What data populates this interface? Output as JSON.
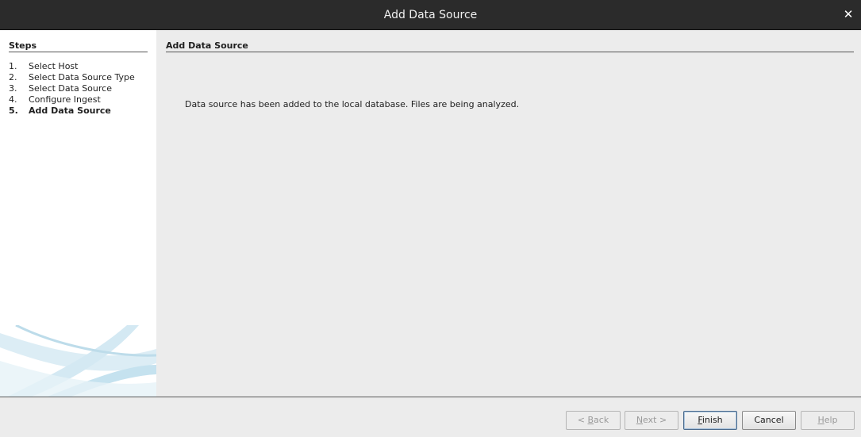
{
  "window": {
    "title": "Add Data Source"
  },
  "steps": {
    "header": "Steps",
    "items": [
      {
        "num": "1.",
        "label": "Select Host"
      },
      {
        "num": "2.",
        "label": "Select Data Source Type"
      },
      {
        "num": "3.",
        "label": "Select Data Source"
      },
      {
        "num": "4.",
        "label": "Configure Ingest"
      },
      {
        "num": "5.",
        "label": "Add Data Source"
      }
    ],
    "current_index": 4
  },
  "content": {
    "header": "Add Data Source",
    "message": "Data source has been added to the local database. Files are being analyzed."
  },
  "buttons": {
    "back": {
      "pre": "< ",
      "mnemonic": "B",
      "rest": "ack",
      "enabled": false
    },
    "next": {
      "pre": "",
      "mnemonic": "N",
      "rest": "ext >",
      "enabled": false
    },
    "finish": {
      "pre": "",
      "mnemonic": "F",
      "rest": "inish",
      "enabled": true
    },
    "cancel": {
      "label": "Cancel",
      "enabled": true
    },
    "help": {
      "pre": "",
      "mnemonic": "H",
      "rest": "elp",
      "enabled": false
    }
  },
  "icons": {
    "close": "close-icon",
    "decoration": "swoosh-graphic"
  },
  "colors": {
    "titlebar": "#2b2b2b",
    "panel": "#ffffff",
    "background": "#ececec",
    "swoosh": "#cfe7f2"
  }
}
